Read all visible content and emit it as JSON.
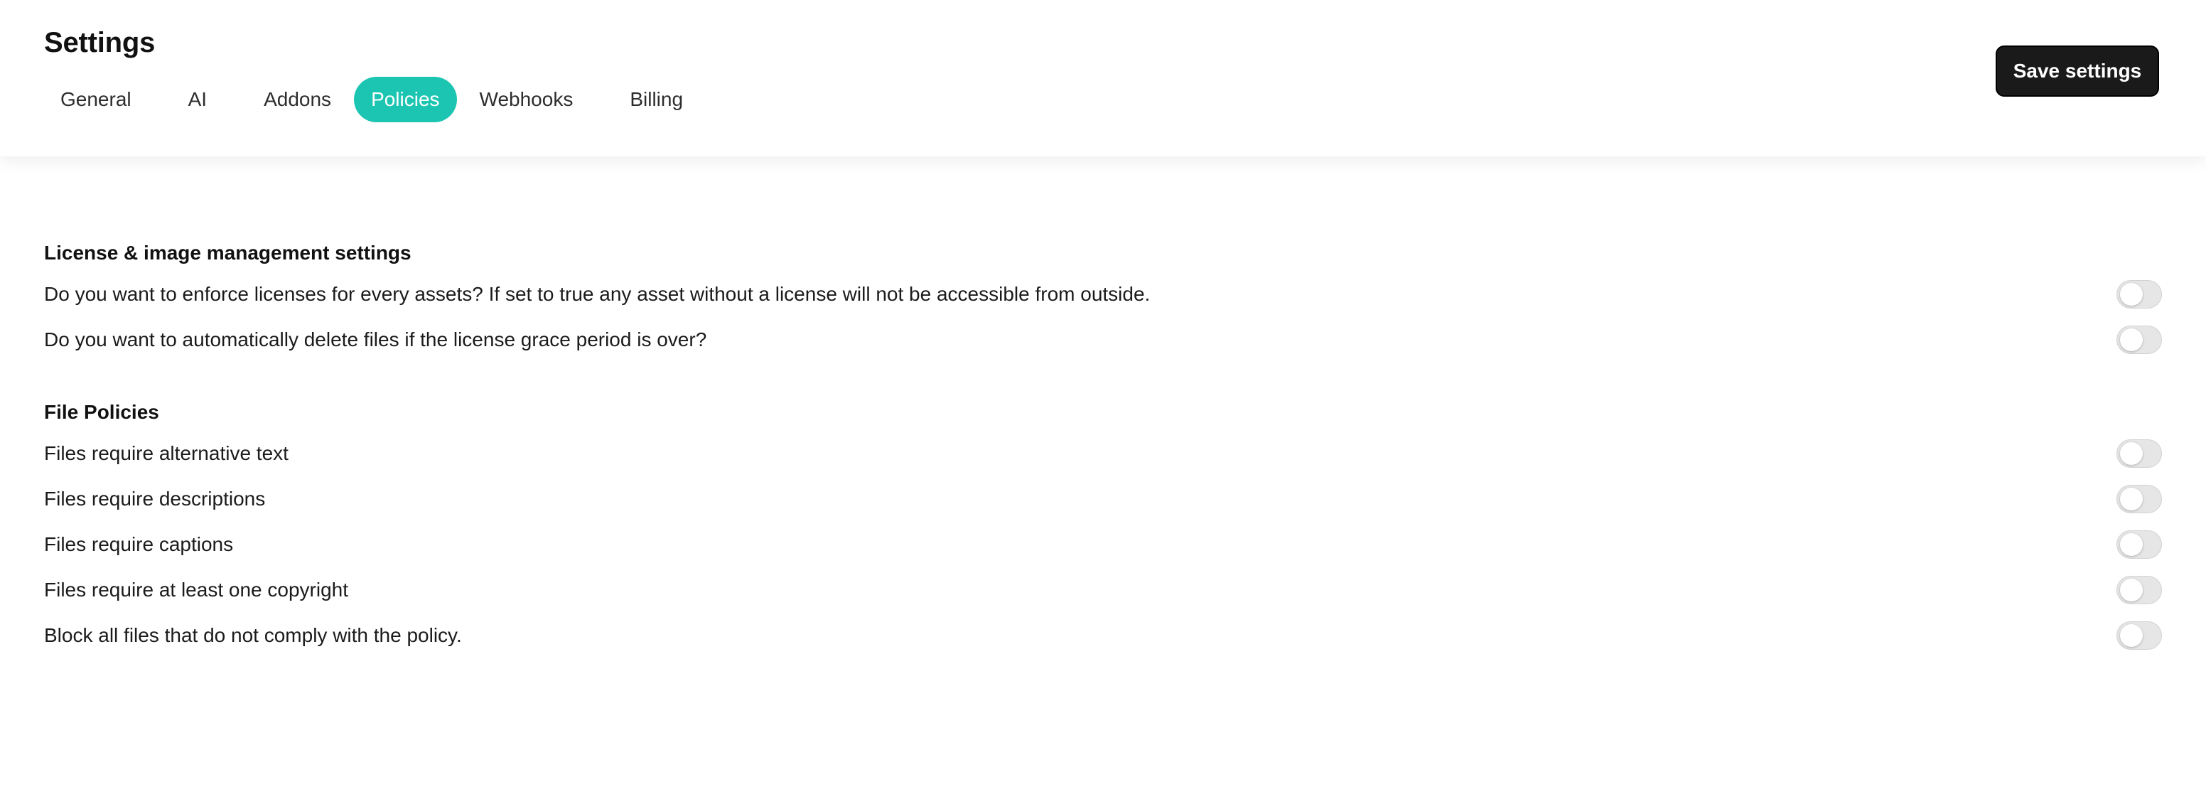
{
  "header": {
    "title": "Settings",
    "save_label": "Save settings"
  },
  "tabs": [
    {
      "label": "General",
      "active": false
    },
    {
      "label": "AI",
      "active": false
    },
    {
      "label": "Addons",
      "active": false
    },
    {
      "label": "Policies",
      "active": true
    },
    {
      "label": "Webhooks",
      "active": false
    },
    {
      "label": "Billing",
      "active": false
    }
  ],
  "license_section": {
    "title": "License & image management settings",
    "items": [
      {
        "label": "Do you want to enforce licenses for every assets? If set to true any asset without a license will not be accessible from outside.",
        "enabled": false
      },
      {
        "label": "Do you want to automatically delete files if the license grace period is over?",
        "enabled": false
      }
    ]
  },
  "file_policies": {
    "title": "File Policies",
    "items": [
      {
        "label": "Files require alternative text",
        "enabled": false
      },
      {
        "label": "Files require descriptions",
        "enabled": false
      },
      {
        "label": "Files require captions",
        "enabled": false
      },
      {
        "label": "Files require at least one copyright",
        "enabled": false
      },
      {
        "label": "Block all files that do not comply with the policy.",
        "enabled": false
      }
    ]
  },
  "colors": {
    "accent": "#1cc5b2",
    "button_bg": "#1a1a1a",
    "toggle_off": "#e6e6e6"
  }
}
